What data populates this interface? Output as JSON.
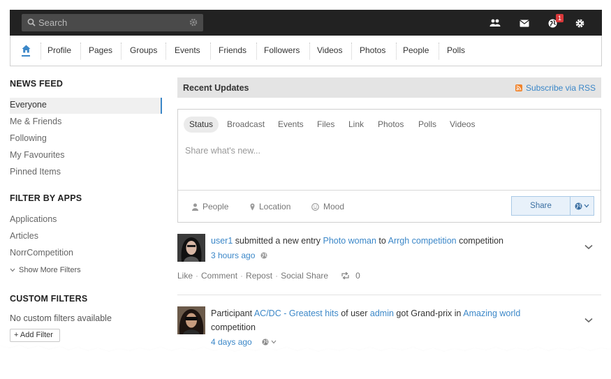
{
  "topbar": {
    "search_placeholder": "Search",
    "icons": [
      "friends-icon",
      "mail-icon",
      "globe-notifications-icon",
      "gear-icon"
    ],
    "notification_count": "1"
  },
  "nav": {
    "home": "home-icon",
    "items": [
      "Profile",
      "Pages",
      "Groups",
      "Events",
      "Friends",
      "Followers",
      "Videos",
      "Photos",
      "People",
      "Polls"
    ]
  },
  "sidebar": {
    "news_feed_heading": "NEWS FEED",
    "feed_items": [
      "Everyone",
      "Me & Friends",
      "Following",
      "My Favourites",
      "Pinned Items"
    ],
    "filter_by_apps_heading": "FILTER BY APPS",
    "app_items": [
      "Applications",
      "Articles",
      "NorrCompetition"
    ],
    "show_more_filters": "Show More Filters",
    "custom_filters_heading": "CUSTOM FILTERS",
    "no_custom_filters": "No custom filters available",
    "add_filter": "Add Filter"
  },
  "recent_updates": {
    "title": "Recent Updates",
    "rss": "Subscribe via RSS"
  },
  "composer": {
    "tabs": [
      "Status",
      "Broadcast",
      "Events",
      "Files",
      "Link",
      "Photos",
      "Polls",
      "Videos"
    ],
    "active_tab": "Status",
    "placeholder": "Share what's new...",
    "options": [
      "People",
      "Location",
      "Mood"
    ],
    "share_button": "Share"
  },
  "feed": [
    {
      "user": "user1",
      "text_1": " submitted a new entry ",
      "link_1": "Photo woman",
      "text_2": " to ",
      "link_2": "Arrgh competition",
      "text_3": " competition",
      "time": "3 hours ago",
      "actions": [
        "Like",
        "Comment",
        "Repost",
        "Social Share"
      ],
      "repost_count": "0"
    },
    {
      "text_0": "Participant ",
      "link_1": "AC/DC - Greatest hits",
      "text_2": " of user ",
      "link_2": "admin",
      "text_3": " got Grand-prix in ",
      "link_3": "Amazing world",
      "text_4": "competition",
      "time": "4 days ago"
    }
  ],
  "colors": {
    "accent": "#3b87c8",
    "topbar": "#222222",
    "badge": "#d9383a",
    "rss": "#f0822a"
  }
}
